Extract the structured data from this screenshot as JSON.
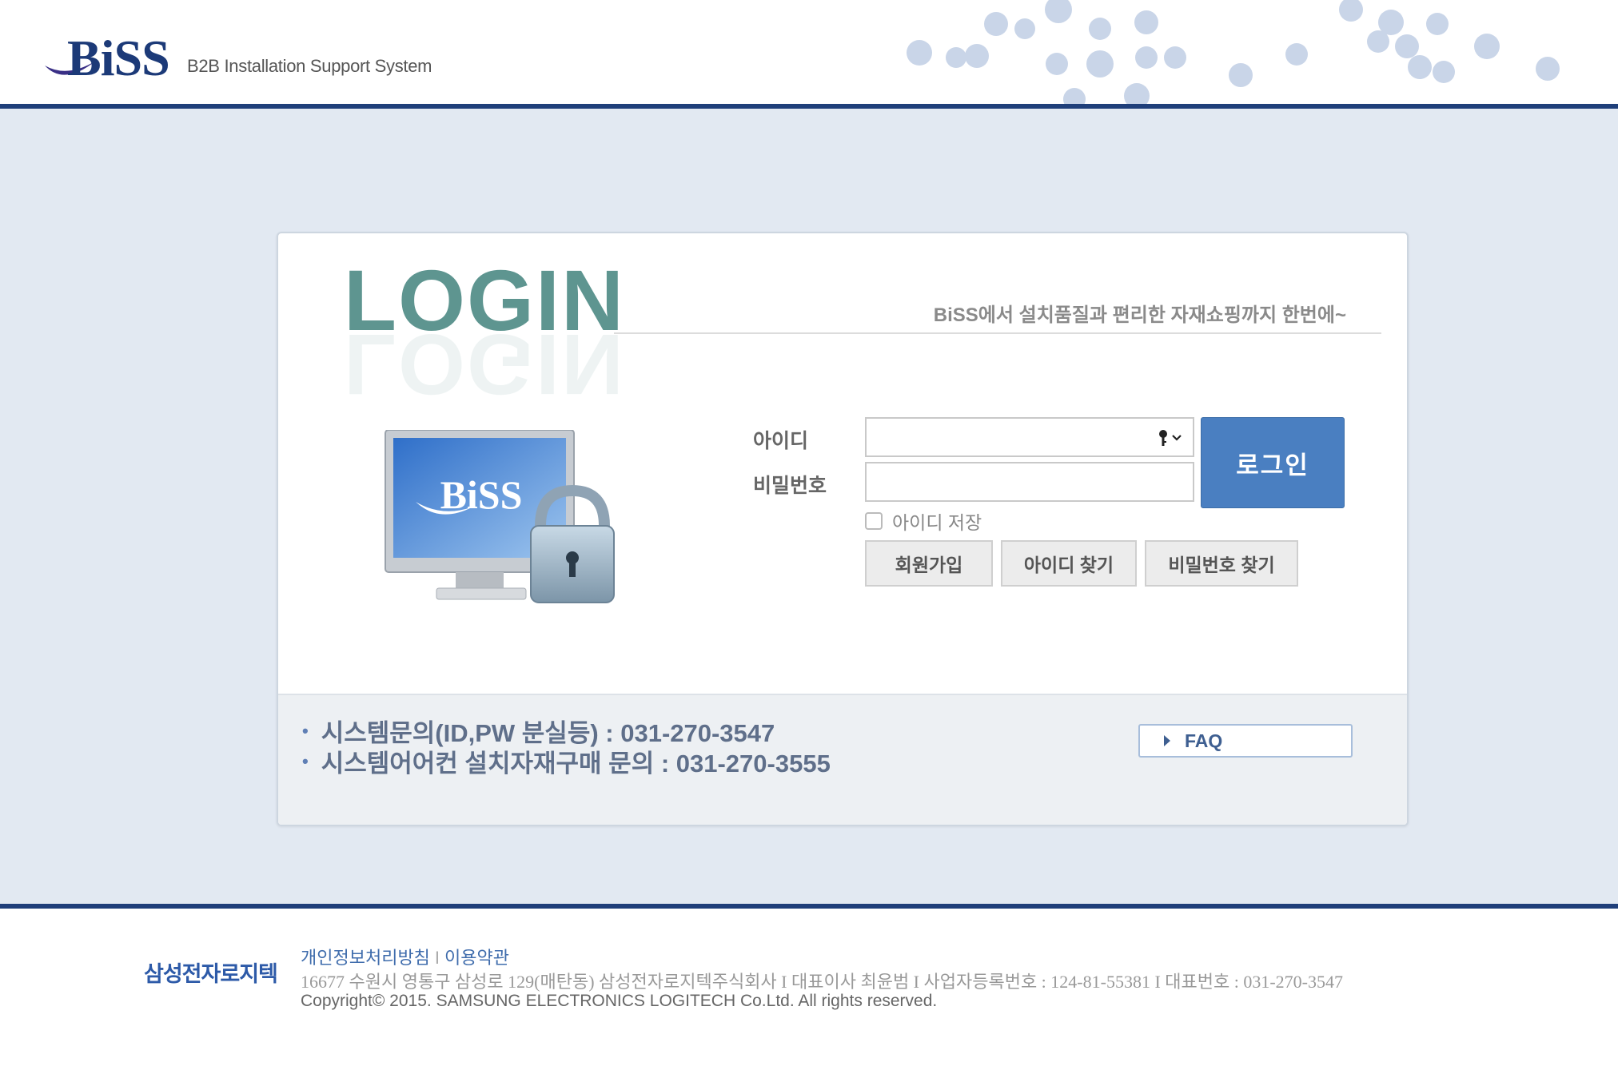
{
  "header": {
    "logo_text": "BiSS",
    "logo_subtitle": "B2B Installation Support System"
  },
  "login": {
    "title": "LOGIN",
    "tagline": "BiSS에서 설치품질과 편리한 자재쇼핑까지 한번에~",
    "monitor_logo_text": "BiSS",
    "id_label": "아이디",
    "password_label": "비밀번호",
    "id_value": "",
    "password_value": "",
    "login_button": "로그인",
    "remember_label": "아이디 저장",
    "remember_checked": false,
    "join_button": "회원가입",
    "find_id_button": "아이디 찾기",
    "find_pw_button": "비밀번호 찾기"
  },
  "contact": {
    "system_inquiry": "시스템문의(ID,PW 분실등) : 031-270-3547",
    "aircon_inquiry": "시스템어어컨 설치자재구매 문의 : 031-270-3555",
    "faq_button": "FAQ"
  },
  "footer": {
    "company_logo": "삼성전자로지텍",
    "privacy_link": "개인정보처리방침",
    "link_separator": "I",
    "terms_link": "이용약관",
    "address": "16677 수원시 영통구 삼성로 129(매탄동) 삼성전자로지텍주식회사 I 대표이사 최윤범 I 사업자등록번호 : 124-81-55381 I 대표번호 : 031-270-3547",
    "copyright": "Copyright© 2015. SAMSUNG ELECTRONICS LOGITECH Co.Ltd. All rights reserved."
  },
  "colors": {
    "navy": "#1f3f7a",
    "band": "#e2e9f2",
    "login_button": "#4a7fc1",
    "title_teal": "#5e9590"
  }
}
